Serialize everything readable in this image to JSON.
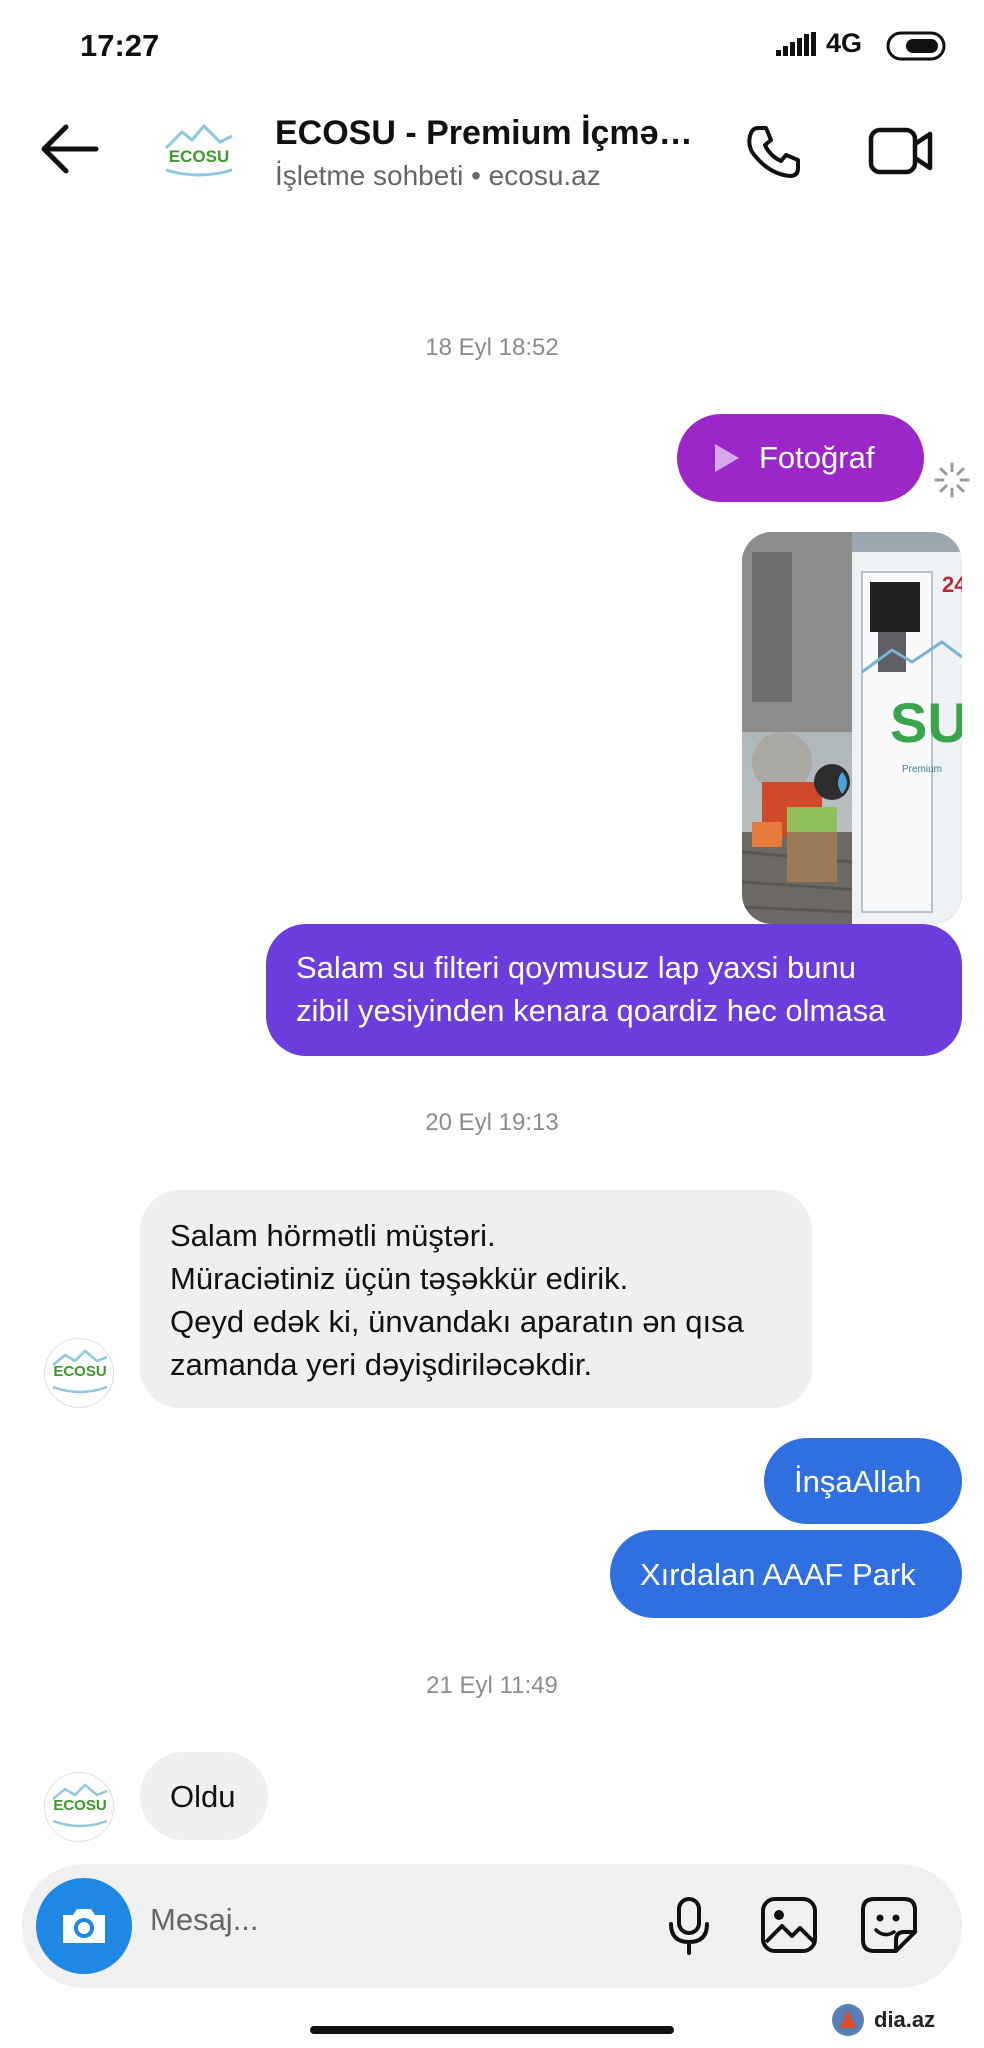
{
  "status_bar": {
    "time": "17:27",
    "network": "4G"
  },
  "header": {
    "avatar_label": "ECOSU",
    "title": "ECOSU - Premium İçmə…",
    "subtitle": "İşletme sohbeti • ecosu.az"
  },
  "timestamps": [
    "18 Eyl 18:52",
    "20 Eyl 19:13",
    "21 Eyl 11:49"
  ],
  "messages": {
    "photo_label": "Fotoğraf",
    "outgoing_1": [
      "Salam su filteri qoymusuz lap yaxsi bunu",
      "zibil yesiyinden kenara qoardiz hec olmasa"
    ],
    "incoming_1": [
      "Salam hörmətli müştəri.",
      "Müraciətiniz üçün təşəkkür edirik.",
      "Qeyd edək ki, ünvandakı aparatın ən qısa",
      "zamanda yeri dəyişdiriləcəkdir."
    ],
    "outgoing_2": "İnşaAllah",
    "outgoing_3": "Xırdalan AAAF Park",
    "incoming_2": "Oldu"
  },
  "composer": {
    "placeholder": "Mesaj..."
  },
  "watermark": "dia.az",
  "colors": {
    "outgoing_blue": "#2f6fe0",
    "outgoing_indigo": "#6a3ddc",
    "photo_purple": "#9b27c9",
    "camera_blue": "#1e88e5",
    "incoming_gray": "#efefef"
  }
}
